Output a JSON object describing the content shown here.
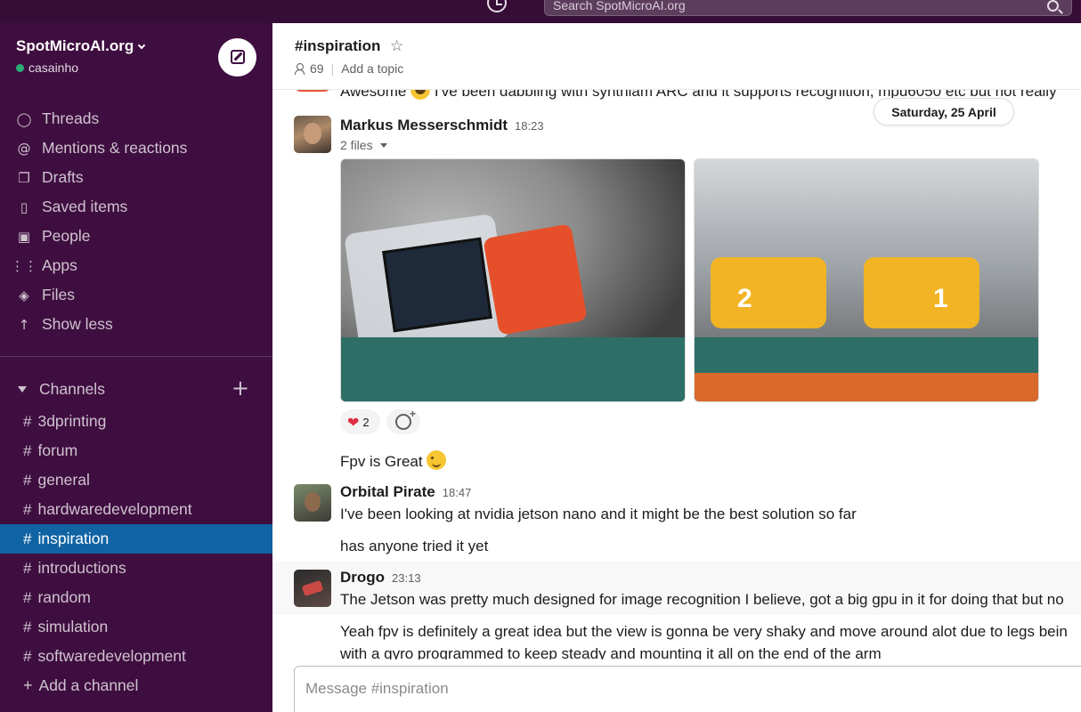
{
  "topbar": {
    "search_placeholder": "Search SpotMicroAI.org"
  },
  "workspace": {
    "name": "SpotMicroAI.org",
    "user": "casainho"
  },
  "nav": {
    "items": [
      {
        "label": "Threads",
        "icon": "threads-icon"
      },
      {
        "label": "Mentions & reactions",
        "icon": "at-icon"
      },
      {
        "label": "Drafts",
        "icon": "drafts-icon"
      },
      {
        "label": "Saved items",
        "icon": "bookmark-icon"
      },
      {
        "label": "People",
        "icon": "people-icon"
      },
      {
        "label": "Apps",
        "icon": "apps-icon"
      },
      {
        "label": "Files",
        "icon": "files-icon"
      },
      {
        "label": "Show less",
        "icon": "arrow-up-icon"
      }
    ]
  },
  "channels": {
    "header": "Channels",
    "items": [
      {
        "name": "3dprinting"
      },
      {
        "name": "forum"
      },
      {
        "name": "general"
      },
      {
        "name": "hardwaredevelopment"
      },
      {
        "name": "inspiration"
      },
      {
        "name": "introductions"
      },
      {
        "name": "random"
      },
      {
        "name": "simulation"
      },
      {
        "name": "softwaredevelopment"
      }
    ],
    "add_label": "Add a channel",
    "active_color": "#1164a3"
  },
  "channel_header": {
    "title": "#inspiration",
    "member_count": "69",
    "topic_placeholder": "Add a topic"
  },
  "date_divider": "Saturday, 25 April",
  "messages": {
    "cut_text": "Awesome",
    "cut_text_rest": "I've been dabbling with synthiam ARC and it supports recognition, mpu6050 etc but not really",
    "markus": {
      "sender": "Markus Messerschmidt",
      "time": "18:23",
      "files_label": "2 files",
      "reaction_count": "2",
      "followup": "Fpv is Great"
    },
    "orbital": {
      "sender": "Orbital Pirate",
      "time": "18:47",
      "text1": "I've been looking at nvidia jetson nano and it might be the best solution so far",
      "text2": "has anyone tried it yet"
    },
    "drogo": {
      "sender": "Drogo",
      "time": "23:13",
      "text1": "The Jetson was pretty much designed for image recognition I believe, got a big gpu in it for doing that but no",
      "text2": "Yeah fpv is definitely a great idea but the view is gonna be very shaky and move around alot due to legs bein",
      "text3": "with a gyro programmed to keep steady and mounting it all on the end of the arm"
    }
  },
  "composer": {
    "placeholder": "Message #inspiration"
  },
  "colors": {
    "sidebar_bg": "#3f0e40",
    "topbar_bg": "#350d36"
  }
}
